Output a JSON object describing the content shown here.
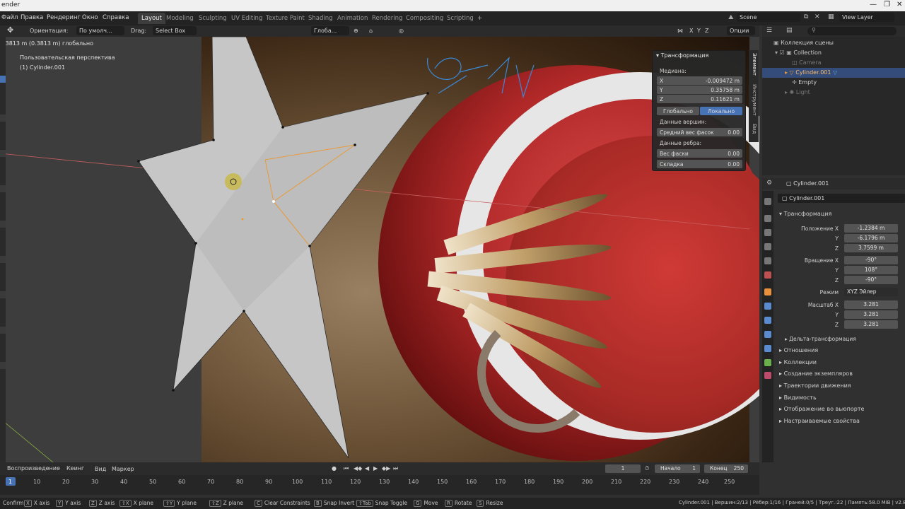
{
  "window": {
    "title": "ender"
  },
  "menus": [
    "Файл",
    "Правка",
    "Рендеринг",
    "Окно",
    "Справка"
  ],
  "workspaces": [
    "Layout",
    "Modeling",
    "Sculpting",
    "UV Editing",
    "Texture Paint",
    "Shading",
    "Animation",
    "Rendering",
    "Compositing",
    "Scripting"
  ],
  "scene": {
    "name": "Scene",
    "view_layer": "View Layer"
  },
  "viewport_header": {
    "orientation_label": "Ориентация:",
    "orientation_value": "По умолч...",
    "drag_label": "Drag:",
    "drag_value": "Select Box",
    "pivot": "Глоба...",
    "axes": [
      "X",
      "Y",
      "Z"
    ],
    "options": "Опции"
  },
  "viewport": {
    "measure": "0.3813 m (0.3813 m) глобально",
    "perspective": "Пользовательская перспектива",
    "object": "(1) Cylinder.001"
  },
  "npanel": {
    "title": "Трансформация",
    "median_label": "Медиана:",
    "x_label": "X",
    "x_value": "-0.009472 m",
    "y_label": "Y",
    "y_value": "0.35758 m",
    "z_label": "Z",
    "z_value": "0.11621 m",
    "global_label": "Глобально",
    "local_label": "Локально",
    "vertex_data_label": "Данные вершин:",
    "bevel_weight_label": "Средний вес фасок",
    "bevel_weight_value": "0.00",
    "edge_data_label": "Данные ребра:",
    "edge_bevel_label": "Вес фаски",
    "edge_bevel_value": "0.00",
    "crease_label": "Складка",
    "crease_value": "0.00",
    "tabs": [
      "Элемент",
      "Инструмент",
      "Вид"
    ]
  },
  "outliner": {
    "root": "Коллекция сцены",
    "items": [
      {
        "label": "Collection",
        "depth": 1
      },
      {
        "label": "Camera",
        "depth": 2
      },
      {
        "label": "Cylinder.001",
        "depth": 2
      },
      {
        "label": "Empty",
        "depth": 2
      },
      {
        "label": "Light",
        "depth": 2
      }
    ]
  },
  "properties": {
    "header_object": "Cylinder.001",
    "object_name": "Cylinder.001",
    "transform_title": "Трансформация",
    "location_label": "Положение X",
    "location": [
      "-1.2384 m",
      "-6.1796 m",
      "3.7599 m"
    ],
    "rotation_label": "Вращение X",
    "rotation": [
      "-90°",
      "108°",
      "-90°"
    ],
    "mode_label": "Режим",
    "mode_value": "XYZ Эйлер",
    "scale_label": "Масштаб X",
    "scale": [
      "3.281",
      "3.281",
      "3.281"
    ],
    "axis_y": "Y",
    "axis_z": "Z",
    "delta": "Дельта-трансформация",
    "sections": [
      "Отношения",
      "Коллекции",
      "Создание экземпляров",
      "Траектории движения",
      "Видимость",
      "Отображение во вьюпорте",
      "Настраиваемые свойства"
    ]
  },
  "timeline": {
    "playback": "Воспроизведение",
    "keying": "Кеинг",
    "view": "Вид",
    "marker": "Маркер",
    "current_frame": "1",
    "start_label": "Начало",
    "start_value": "1",
    "end_label": "Конец",
    "end_value": "250",
    "ticks": [
      "1",
      "10",
      "20",
      "30",
      "40",
      "50",
      "60",
      "70",
      "80",
      "90",
      "100",
      "110",
      "120",
      "130",
      "140",
      "150",
      "160",
      "170",
      "180",
      "190",
      "200",
      "210",
      "220",
      "230",
      "240",
      "250"
    ]
  },
  "statusbar": {
    "items": [
      {
        "key": "",
        "label": "Confirm"
      },
      {
        "key": "X",
        "label": "X axis"
      },
      {
        "key": "Y",
        "label": "Y axis"
      },
      {
        "key": "Z",
        "label": "Z axis"
      },
      {
        "key": "⇧X",
        "label": "X plane"
      },
      {
        "key": "⇧Y",
        "label": "Y plane"
      },
      {
        "key": "⇧Z",
        "label": "Z plane"
      },
      {
        "key": "C",
        "label": "Clear Constraints"
      },
      {
        "key": "B",
        "label": "Snap Invert"
      },
      {
        "key": "⇧Tab",
        "label": "Snap Toggle"
      },
      {
        "key": "G",
        "label": "Move"
      },
      {
        "key": "R",
        "label": "Rotate"
      },
      {
        "key": "S",
        "label": "Resize"
      }
    ],
    "info": "Cylinder.001 | Вершин:2/13 | Рёбер:1/16 | Граней:0/5 | Треуг.:22 | Память:58.0 MiB | v2.82"
  },
  "colors": {
    "accent": "#4772b3",
    "selection": "#ffa040"
  }
}
